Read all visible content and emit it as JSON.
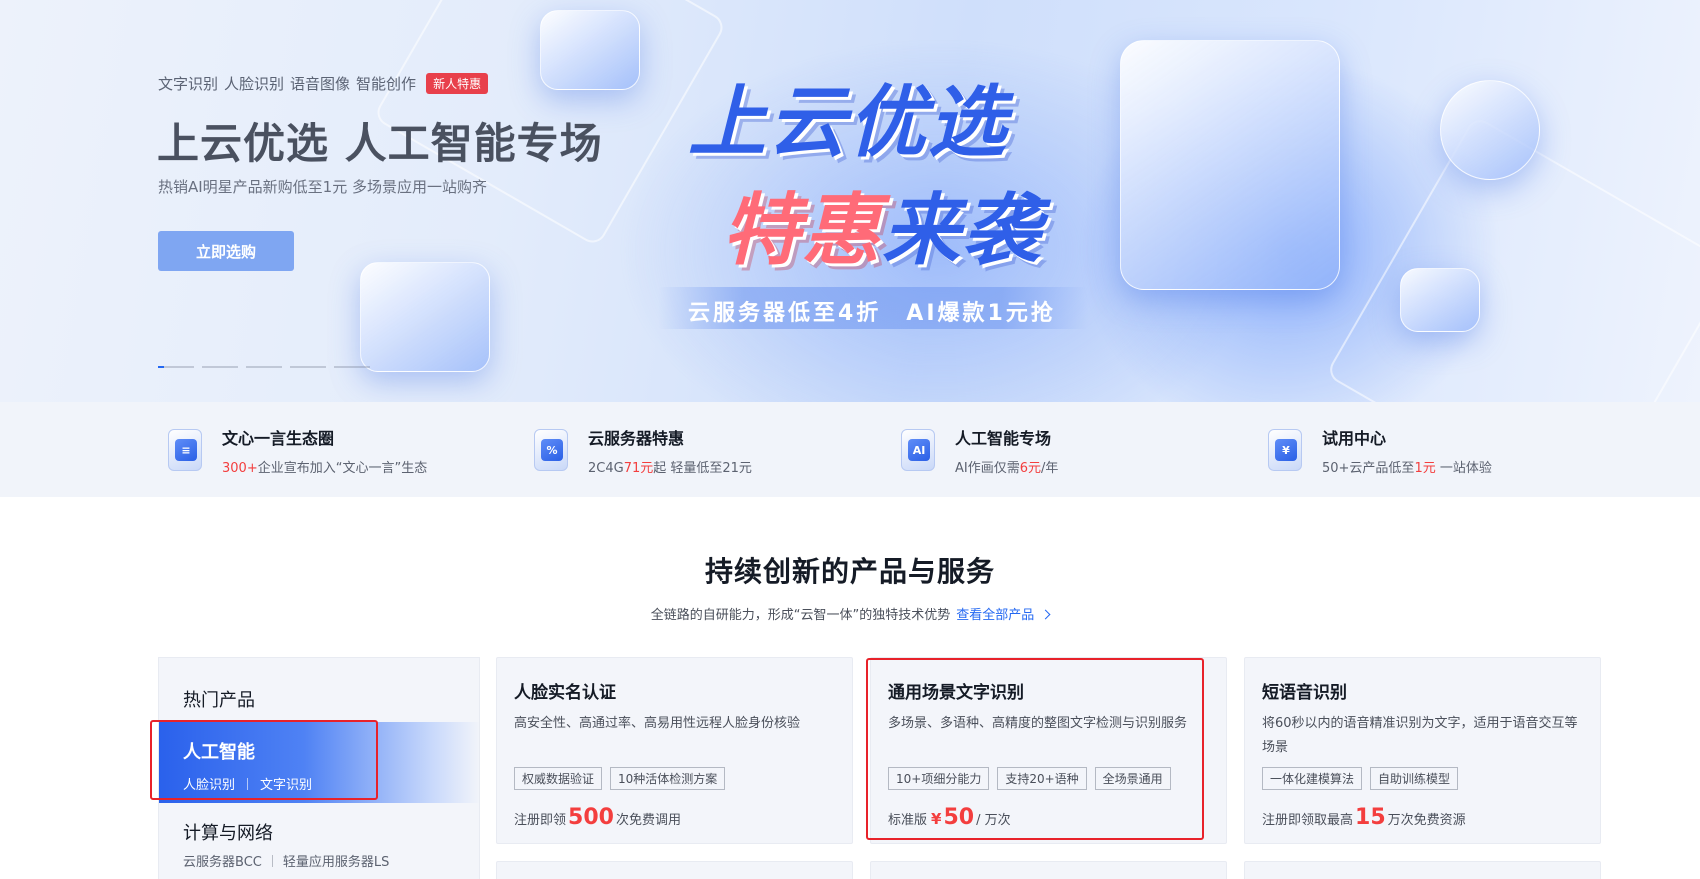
{
  "hero": {
    "tags": [
      "文字识别",
      "人脸识别",
      "语音图像",
      "智能创作"
    ],
    "badge": "新人特惠",
    "title": "上云优选 人工智能专场",
    "subtitle": "热销AI明星产品新购低至1元 多场景应用一站购齐",
    "cta": "立即选购",
    "promo_line1": "上云优选",
    "promo_line2a": "特惠",
    "promo_line2b": "来袭",
    "promo_strip": "云服务器低至4折　AI爆款1元抢",
    "carousel_count": 5,
    "carousel_active": 1
  },
  "features": [
    {
      "icon": "doc-icon",
      "glyph": "≡",
      "title": "文心一言生态圈",
      "pre": "",
      "hl": "300+",
      "post": "企业宣布加入“文心一言”生态"
    },
    {
      "icon": "discount-icon",
      "glyph": "%",
      "title": "云服务器特惠",
      "pre": "2C4G",
      "hl": "71元",
      "post": "起 轻量低至21元"
    },
    {
      "icon": "ai-chip-icon",
      "glyph": "AI",
      "title": "人工智能专场",
      "pre": "AI作画仅需",
      "hl": "6元",
      "post": "/年"
    },
    {
      "icon": "trial-coupon-icon",
      "glyph": "¥",
      "title": "试用中心",
      "pre": "50+云产品低至",
      "hl": "1元",
      "post": " 一站体验"
    }
  ],
  "section": {
    "title": "持续创新的产品与服务",
    "subtitle": "全链路的自研能力，形成“云智一体”的独特技术优势",
    "link": "查看全部产品"
  },
  "categories": {
    "heading": "热门产品",
    "active": {
      "name": "人工智能",
      "links": [
        "人脸识别",
        "文字识别"
      ]
    },
    "next": {
      "name": "计算与网络",
      "links": [
        "云服务器BCC",
        "轻量应用服务器LS"
      ]
    }
  },
  "cards": [
    {
      "title": "人脸实名认证",
      "desc": "高安全性、高通过率、高易用性远程人脸身份核验",
      "tags": [
        "权威数据验证",
        "10种活体检测方案"
      ],
      "price_pre": "注册即领",
      "price_cur": "",
      "price_val": "500",
      "price_post": "次免费调用"
    },
    {
      "title": "通用场景文字识别",
      "desc": "多场景、多语种、高精度的整图文字检测与识别服务",
      "tags": [
        "10+项细分能力",
        "支持20+语种",
        "全场景通用"
      ],
      "price_pre": "标准版",
      "price_cur": "¥",
      "price_val": "50",
      "price_post": "/ 万次"
    },
    {
      "title": "短语音识别",
      "desc": "将60秒以内的语音精准识别为文字，适用于语音交互等场景",
      "tags": [
        "一体化建模算法",
        "自助训练模型"
      ],
      "price_pre": "注册即领取最高",
      "price_cur": "",
      "price_val": "15",
      "price_post": "万次免费资源"
    }
  ],
  "colors": {
    "accent": "#2468f2",
    "price_red": "#f33e3e",
    "highlight_box": "#e8222a"
  }
}
